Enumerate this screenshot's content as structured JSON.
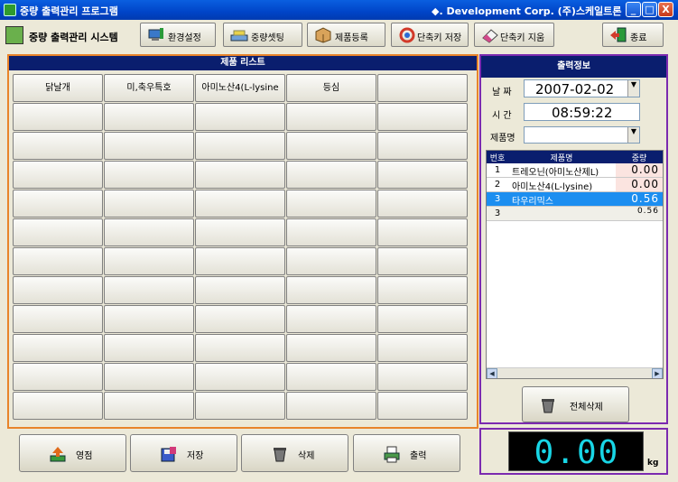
{
  "window": {
    "title": "중량 출력관리 프로그램",
    "company": "◆. Development Corp. (주)스케일트론",
    "minimize": "_",
    "maximize": "□",
    "close": "X"
  },
  "toolbar": {
    "system_title": "중량 출력관리 시스템",
    "settings": "환경설정",
    "weight_setting": "중량셋팅",
    "product_register": "제품등록",
    "shortcut_save": "단축키 저장",
    "shortcut_delete": "단축키 지움",
    "exit": "종료"
  },
  "product_list": {
    "header": "제품 리스트",
    "cells": [
      [
        "닭날개",
        "미,축우특호",
        "아미노산4(L-lysine",
        "등심",
        ""
      ],
      [
        "",
        "",
        "",
        "",
        ""
      ],
      [
        "",
        "",
        "",
        "",
        ""
      ],
      [
        "",
        "",
        "",
        "",
        ""
      ],
      [
        "",
        "",
        "",
        "",
        ""
      ],
      [
        "",
        "",
        "",
        "",
        ""
      ],
      [
        "",
        "",
        "",
        "",
        ""
      ],
      [
        "",
        "",
        "",
        "",
        ""
      ],
      [
        "",
        "",
        "",
        "",
        ""
      ],
      [
        "",
        "",
        "",
        "",
        ""
      ],
      [
        "",
        "",
        "",
        "",
        ""
      ],
      [
        "",
        "",
        "",
        "",
        ""
      ]
    ]
  },
  "bottom_buttons": {
    "zero": "영점",
    "save": "저장",
    "delete": "삭제",
    "print": "출력"
  },
  "output_info": {
    "header": "출력정보",
    "date_label": "날 짜",
    "date_value": "2007-02-02",
    "time_label": "시 간",
    "time_value": "08:59:22",
    "product_label": "제품명",
    "product_value": "",
    "table": {
      "columns": [
        "번호",
        "제품명",
        "중량"
      ],
      "rows": [
        {
          "no": "1",
          "name": "트레오닌(아미노산제L)",
          "weight": "0.00"
        },
        {
          "no": "2",
          "name": "아미노산4(L-lysine)",
          "weight": "0.00"
        },
        {
          "no": "3",
          "name": "타우리믹스",
          "weight": "0.56"
        }
      ],
      "total": {
        "no": "3",
        "weight": "0.56"
      }
    },
    "delete_all": "전체삭제"
  },
  "display": {
    "weight": "0.00",
    "unit": "kg"
  },
  "colors": {
    "title_bar": "#0a5fe0",
    "panel_header": "#0a1e6e",
    "list_border": "#e8842a",
    "info_border": "#7b2ab0",
    "selected_row": "#1c8ef0",
    "display_digits": "#18d6e6"
  }
}
